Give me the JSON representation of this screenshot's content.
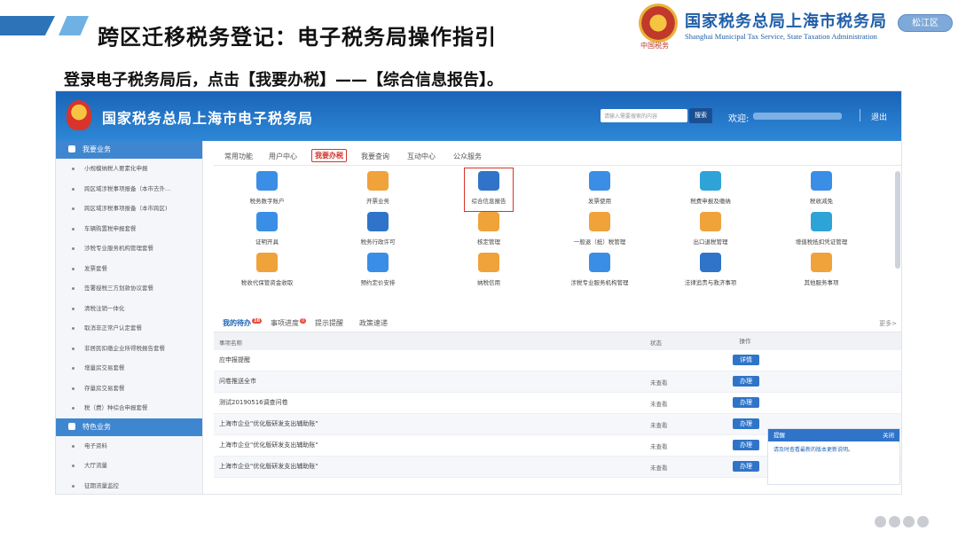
{
  "slide": {
    "title": "跨区迁移税务登记：电子税务局操作指引",
    "agency_cn": "国家税务总局上海市税务局",
    "agency_en": "Shanghai Municipal Tax Service, State Taxation Administration",
    "emblem_caption": "中国税务",
    "district": "松江区",
    "instruction": "登录电子税务局后，点击【我要办税】——【综合信息报告】。"
  },
  "app": {
    "site_title": "国家税务总局上海市电子税务局",
    "search_placeholder": "请输入需要搜索的内容",
    "search_btn": "搜索",
    "welcome": "欢迎:",
    "logout": "退出"
  },
  "sidebar": {
    "section1": "我要业务",
    "items1": [
      "小规模纳税人要素化申报",
      "跨区域涉税事项报备（本市去外...",
      "跨区域涉税事项报备（本市跨区)",
      "车辆购置税申报套餐",
      "涉税专业服务机构管理套餐",
      "发票套餐",
      "签署授税三方划款协议套餐",
      "清税注销一体化",
      "取消非正常户认定套餐",
      "非居民扣缴企业所得税报告套餐",
      "增量房交易套餐",
      "存量房交易套餐",
      "税（费）种综合申报套餐"
    ],
    "section2": "特色业务",
    "items2": [
      "电子资料",
      "大厅流量",
      "征期流量监控"
    ]
  },
  "tabs": [
    "常用功能",
    "用户中心",
    "我要办税",
    "我要查询",
    "互动中心",
    "公众服务"
  ],
  "functions": [
    "税务数字账户",
    "开票业务",
    "综合信息报告",
    "发票使用",
    "税费申报及缴纳",
    "税收减免",
    "证明开具",
    "税务行政许可",
    "核定管理",
    "一般退（抵）税管理",
    "出口退税管理",
    "增值税抵扣凭证管理",
    "税收代保管资金收取",
    "预约定价安排",
    "纳税信用",
    "涉税专业服务机构管理",
    "法律追责与救济事项",
    "其他服务事项"
  ],
  "tasks": {
    "tabs": [
      "我的待办",
      "事项进度",
      "提示提醒",
      "政策速递"
    ],
    "badges": [
      "10",
      "0"
    ],
    "more": "更多>",
    "headers": [
      "事项名称",
      "状态",
      "操作"
    ],
    "rows": [
      {
        "name": "应申报提醒",
        "status": "",
        "action": "详情"
      },
      {
        "name": "问卷推送全市",
        "status": "未查看",
        "action": "办理"
      },
      {
        "name": "测试20190516调查问卷",
        "status": "未查看",
        "action": "办理"
      },
      {
        "name": "上海市企业\"优化版研发支出辅助账\"",
        "status": "未查看",
        "action": "办理"
      },
      {
        "name": "上海市企业\"优化版研发支出辅助账\"",
        "status": "未查看",
        "action": "办理"
      },
      {
        "name": "上海市企业\"优化版研发支出辅助账\"",
        "status": "未查看",
        "action": "办理"
      }
    ]
  },
  "notice": {
    "title": "提醒",
    "close": "关闭",
    "body": "请及时查看最新的版本更新说明。"
  },
  "colors": {
    "primary": "#2f74c9",
    "highlight": "#d9342b"
  }
}
